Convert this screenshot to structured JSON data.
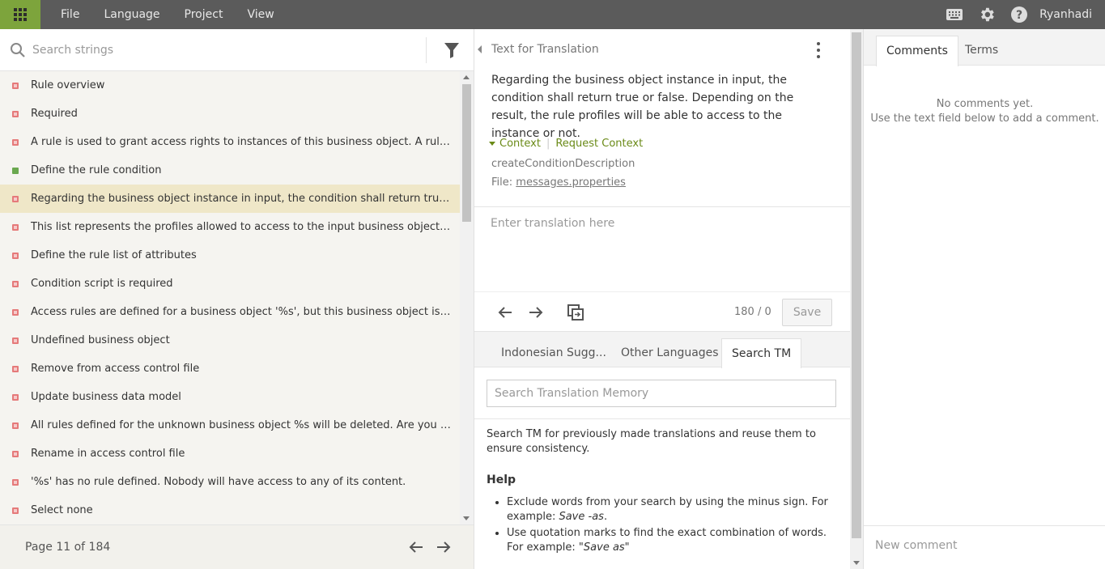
{
  "topbar": {
    "menu": [
      "File",
      "Language",
      "Project",
      "View"
    ],
    "username": "Ryanhadi",
    "icons": [
      "apps-grid-icon",
      "keyboard-icon",
      "gear-icon",
      "help-icon"
    ],
    "accent": "#7da43c"
  },
  "left": {
    "search_placeholder": "Search strings",
    "strings": [
      {
        "text": "Rule overview",
        "status": "untranslated"
      },
      {
        "text": "Required",
        "status": "untranslated"
      },
      {
        "text": "A rule is used to grant access rights to instances of this business object. A rule is co...",
        "status": "untranslated"
      },
      {
        "text": "Define the rule condition",
        "status": "translated"
      },
      {
        "text": "Regarding the business object instance in input, the condition shall return true or fa...",
        "status": "untranslated",
        "selected": true
      },
      {
        "text": "This list represents the profiles allowed to access to the input business object instan...",
        "status": "untranslated"
      },
      {
        "text": "Define the rule list of attributes",
        "status": "untranslated"
      },
      {
        "text": "Condition script is required",
        "status": "untranslated"
      },
      {
        "text": "Access rules are defined for a business object '%s', but this business object is undefi...",
        "status": "untranslated"
      },
      {
        "text": "Undefined business object",
        "status": "untranslated"
      },
      {
        "text": "Remove from access control file",
        "status": "untranslated"
      },
      {
        "text": "Update business data model",
        "status": "untranslated"
      },
      {
        "text": "All rules defined for the unknown business object %s will be deleted. Are you sure?",
        "status": "untranslated"
      },
      {
        "text": "Rename in access control file",
        "status": "untranslated"
      },
      {
        "text": "'%s' has no rule defined. Nobody will have access to any of its content.",
        "status": "untranslated"
      },
      {
        "text": "Select none",
        "status": "untranslated"
      }
    ],
    "page_label": "Page 11 of 184"
  },
  "mid": {
    "title": "Text for Translation",
    "source_text": "Regarding the business object instance in input, the condition shall return true or false. Depending on the result, the rule profiles will be able to access to the instance or not.",
    "context_label": "Context",
    "request_context_label": "Request Context",
    "context_key": "createConditionDescription",
    "file_label": "File:",
    "file_name": "messages.properties",
    "translation_placeholder": "Enter translation here",
    "char_count": "180 / 0",
    "save_label": "Save",
    "tabs": [
      "Indonesian Sugg...",
      "Other Languages",
      "Search TM"
    ],
    "tm_search_placeholder": "Search Translation Memory",
    "tm_intro": "Search TM for previously made translations and reuse them to ensure consistency.",
    "help_title": "Help",
    "help_1_text": "Exclude words from your search by using the minus sign. For example: ",
    "help_1_example": "Save -as",
    "help_1_end": ".",
    "help_2_text": "Use quotation marks to find the exact combination of words. For example: ",
    "help_2_example": "\"Save as\""
  },
  "right": {
    "tabs": [
      "Comments",
      "Terms"
    ],
    "no_comments": "No comments yet.",
    "no_comments_hint": "Use the text field below to add a comment.",
    "comment_placeholder": "New comment"
  }
}
